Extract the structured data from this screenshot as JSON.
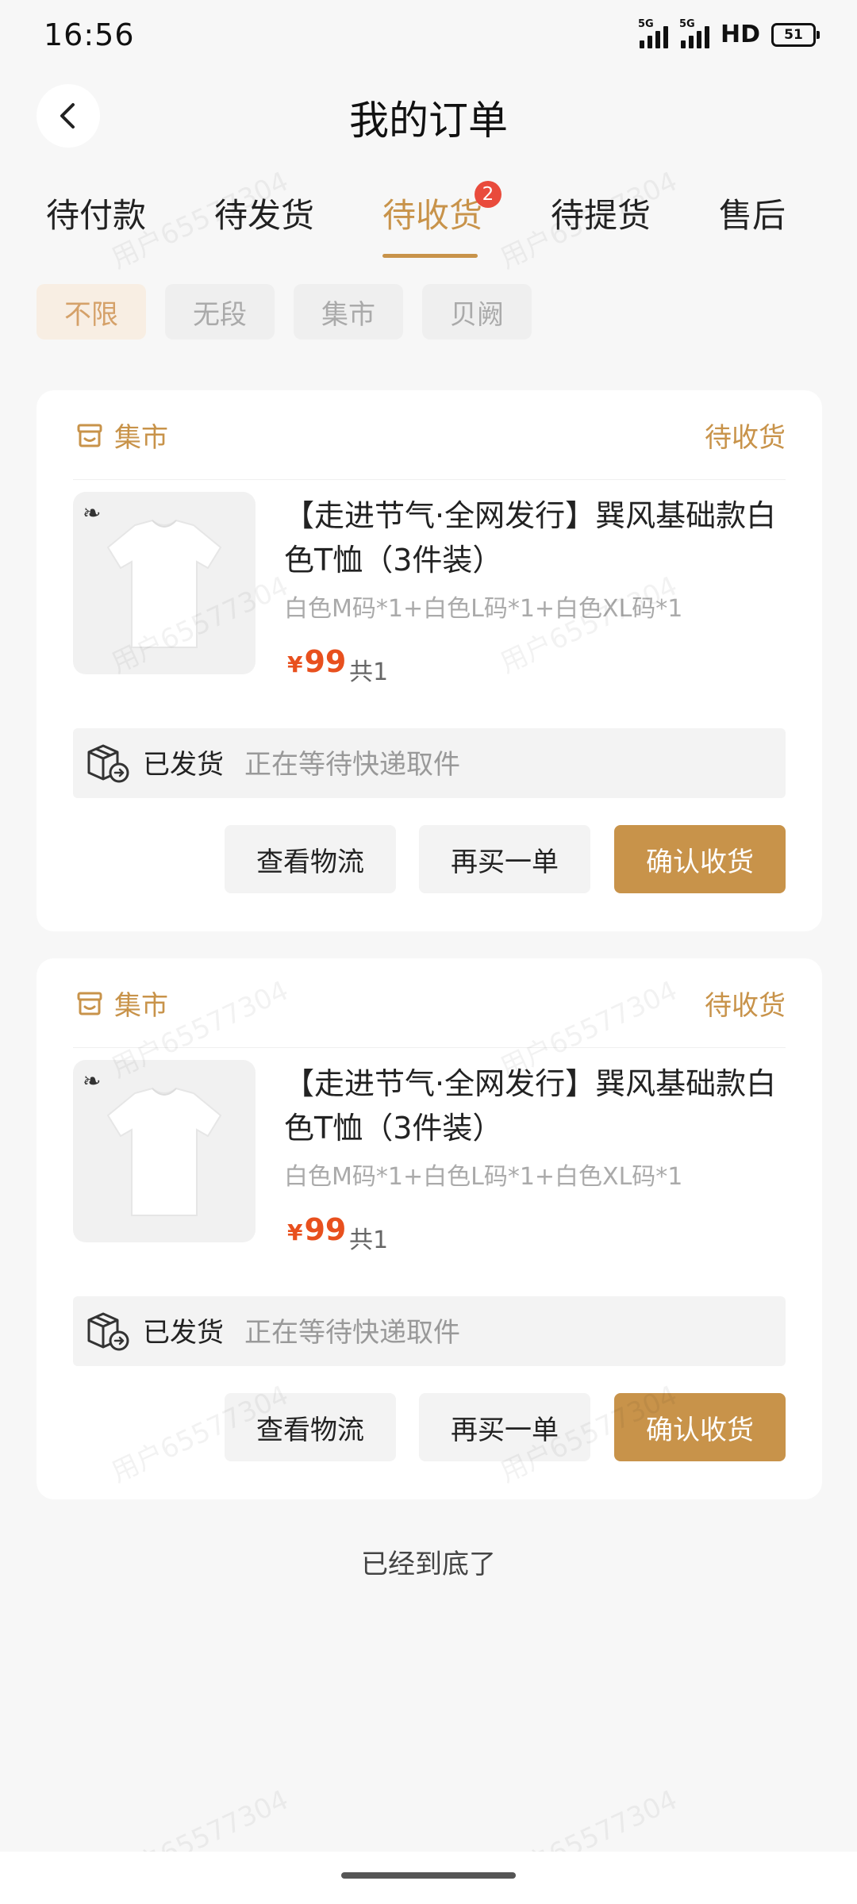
{
  "status_bar": {
    "time": "16:56",
    "network1": "5G",
    "network2": "5G",
    "hd": "HD",
    "battery": "51"
  },
  "header": {
    "title": "我的订单",
    "back_icon": "chevron-left-icon"
  },
  "tabs": [
    {
      "label": "待付款",
      "active": false
    },
    {
      "label": "待发货",
      "active": false
    },
    {
      "label": "待收货",
      "active": true,
      "badge": "2"
    },
    {
      "label": "待提货",
      "active": false
    },
    {
      "label": "售后",
      "active": false
    }
  ],
  "filters": [
    {
      "label": "不限",
      "active": true
    },
    {
      "label": "无段",
      "active": false
    },
    {
      "label": "集市",
      "active": false
    },
    {
      "label": "贝阙",
      "active": false
    }
  ],
  "orders": [
    {
      "store": "集市",
      "status": "待收货",
      "product_title": "【走进节气·全网发行】巽风基础款白色T恤（3件装）",
      "spec": "白色M码*1+白色L码*1+白色XL码*1",
      "currency": "¥",
      "price": "99",
      "quantity": "共1",
      "ship_status": "已发货",
      "ship_desc": "正在等待快递取件",
      "buttons": {
        "logistics": "查看物流",
        "rebuy": "再买一单",
        "confirm": "确认收货"
      }
    },
    {
      "store": "集市",
      "status": "待收货",
      "product_title": "【走进节气·全网发行】巽风基础款白色T恤（3件装）",
      "spec": "白色M码*1+白色L码*1+白色XL码*1",
      "currency": "¥",
      "price": "99",
      "quantity": "共1",
      "ship_status": "已发货",
      "ship_desc": "正在等待快递取件",
      "buttons": {
        "logistics": "查看物流",
        "rebuy": "再买一单",
        "confirm": "确认收货"
      }
    }
  ],
  "end_text": "已经到底了",
  "watermark": "用户65577304",
  "colors": {
    "accent": "#c8934a",
    "price": "#e8501e",
    "badge": "#e94b3c",
    "background": "#f7f7f7"
  }
}
